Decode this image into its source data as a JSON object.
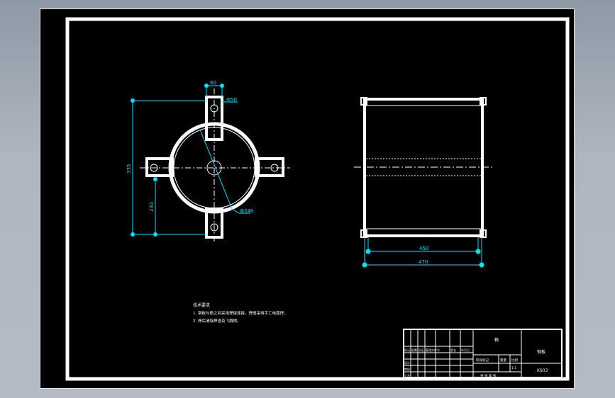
{
  "drawing": {
    "dims": {
      "top_width": "60",
      "diameter_small": "Ф50",
      "overall_height": "335",
      "lower_height": "230",
      "diameter_ring": "Ф346",
      "inner_width": "450",
      "outer_width": "470"
    },
    "notes": {
      "title": "技术要求",
      "line1": "1. 钢板与筋之间采用焊接连接，焊缝采用手工电弧焊。",
      "line2": "2. 焊后清除焊渣及飞溅物。"
    },
    "title_block": {
      "name": "箱",
      "material": "钢板",
      "part_no": "KS03",
      "scale": "1:1",
      "row_labels": [
        "标记",
        "处数",
        "分区",
        "更改文件号",
        "签名",
        "年月日"
      ],
      "side_labels": [
        "设计",
        "审核",
        "工艺"
      ],
      "stage_label": "阶段标记",
      "weight_label": "重量",
      "ratio_label": "比例",
      "sheet_info": "共  张  第  张"
    }
  }
}
